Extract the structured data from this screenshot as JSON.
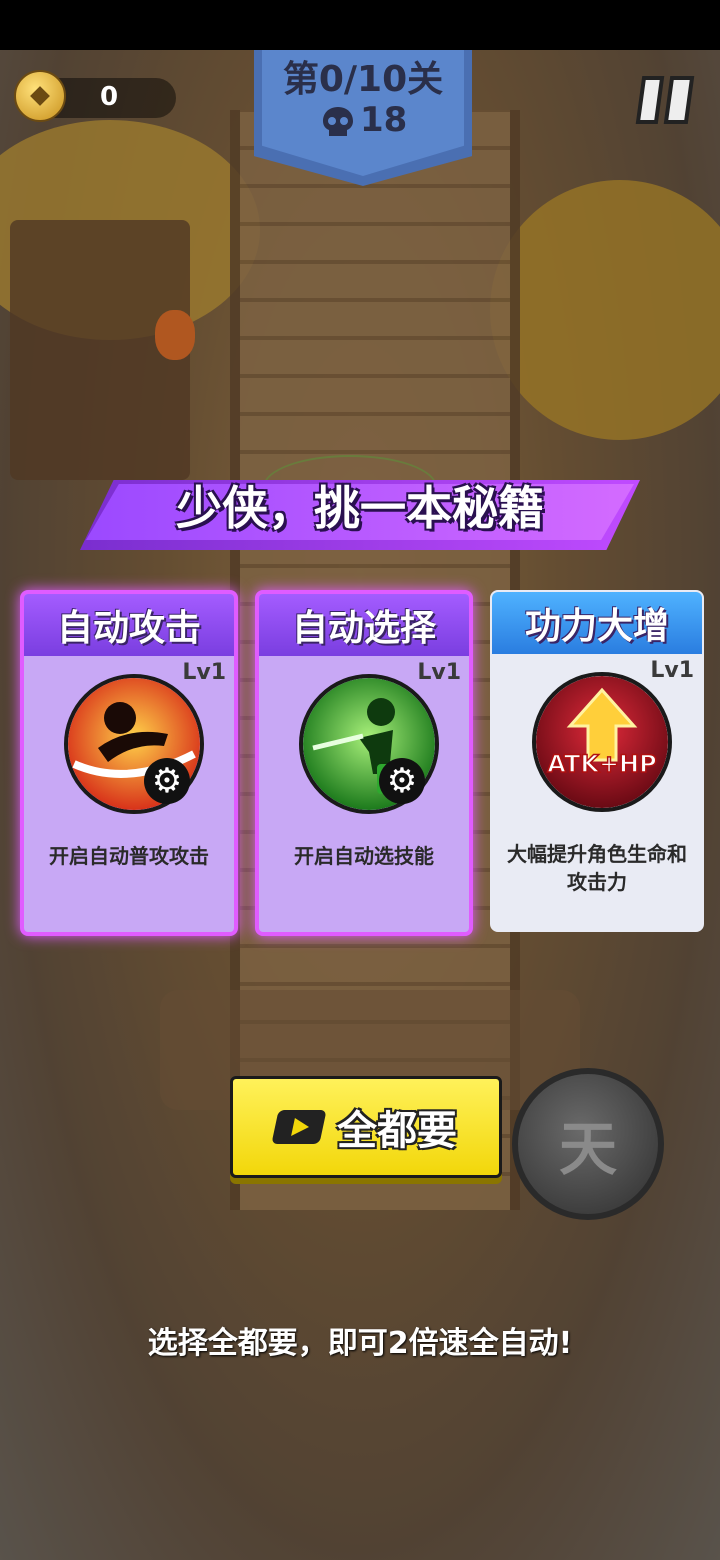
{
  "hud": {
    "coins": "0",
    "level": "第0/10关",
    "kills": "18"
  },
  "dialog": {
    "title": "少侠，挑一本秘籍",
    "cards": [
      {
        "title": "自动攻击",
        "level": "Lv1",
        "desc": "开启自动普攻攻击",
        "icon": "sword-slash-icon",
        "theme": "#a45cff"
      },
      {
        "title": "自动选择",
        "level": "Lv1",
        "desc": "开启自动选技能",
        "icon": "auto-select-icon",
        "theme": "#a45cff"
      },
      {
        "title": "功力大增",
        "level": "Lv1",
        "desc": "大幅提升角色生命和攻击力",
        "icon_text": "ATK+HP",
        "icon": "atk-hp-boost-icon",
        "theme": "#4fb2ff"
      }
    ],
    "take_all_label": "全都要",
    "side_button_label": "天",
    "hint": "选择全都要，即可2倍速全自动!"
  }
}
